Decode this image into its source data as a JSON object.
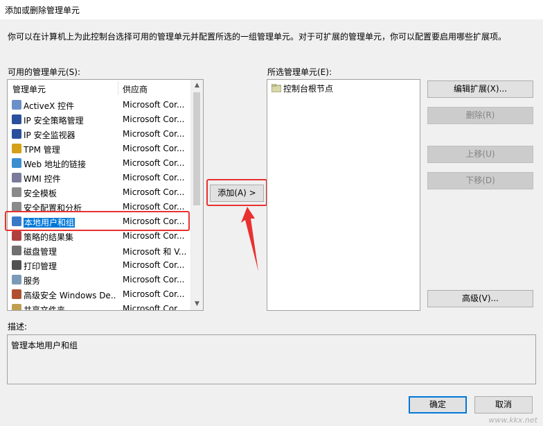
{
  "window": {
    "title": "添加或删除管理单元"
  },
  "intro": "你可以在计算机上为此控制台选择可用的管理单元并配置所选的一组管理单元。对于可扩展的管理单元，你可以配置要启用哪些扩展项。",
  "available": {
    "label": "可用的管理单元(S):",
    "col_name": "管理单元",
    "col_vendor": "供应商",
    "items": [
      {
        "name": "ActiveX 控件",
        "vendor": "Microsoft Cor...",
        "icon": "activex-icon"
      },
      {
        "name": "IP 安全策略管理",
        "vendor": "Microsoft Cor...",
        "icon": "ip-policy-icon"
      },
      {
        "name": "IP 安全监视器",
        "vendor": "Microsoft Cor...",
        "icon": "ip-monitor-icon"
      },
      {
        "name": "TPM 管理",
        "vendor": "Microsoft Cor...",
        "icon": "tpm-icon"
      },
      {
        "name": "Web 地址的链接",
        "vendor": "Microsoft Cor...",
        "icon": "web-link-icon"
      },
      {
        "name": "WMI 控件",
        "vendor": "Microsoft Cor...",
        "icon": "wmi-icon"
      },
      {
        "name": "安全模板",
        "vendor": "Microsoft Cor...",
        "icon": "security-template-icon"
      },
      {
        "name": "安全配置和分析",
        "vendor": "Microsoft Cor...",
        "icon": "security-config-icon"
      },
      {
        "name": "本地用户和组",
        "vendor": "Microsoft Cor...",
        "icon": "users-icon",
        "selected": true
      },
      {
        "name": "策略的结果集",
        "vendor": "Microsoft Cor...",
        "icon": "rsop-icon"
      },
      {
        "name": "磁盘管理",
        "vendor": "Microsoft 和 V...",
        "icon": "disk-icon"
      },
      {
        "name": "打印管理",
        "vendor": "Microsoft Cor...",
        "icon": "printer-icon"
      },
      {
        "name": "服务",
        "vendor": "Microsoft Cor...",
        "icon": "services-gear-icon"
      },
      {
        "name": "高级安全 Windows De...",
        "vendor": "Microsoft Cor...",
        "icon": "firewall-icon"
      },
      {
        "name": "共享文件夹",
        "vendor": "Microsoft Cor...",
        "icon": "shared-folder-icon"
      }
    ]
  },
  "add_button": "添加(A) >",
  "selected": {
    "label": "所选管理单元(E):",
    "root": "控制台根节点"
  },
  "buttons": {
    "edit_ext": "编辑扩展(X)...",
    "remove": "删除(R)",
    "move_up": "上移(U)",
    "move_down": "下移(D)",
    "advanced": "高级(V)...",
    "ok": "确定",
    "cancel": "取消"
  },
  "description": {
    "label": "描述:",
    "text": "管理本地用户和组"
  },
  "watermark": "www.kkx.net",
  "colors": {
    "selection": "#0078d7",
    "highlight": "#e8312f"
  }
}
